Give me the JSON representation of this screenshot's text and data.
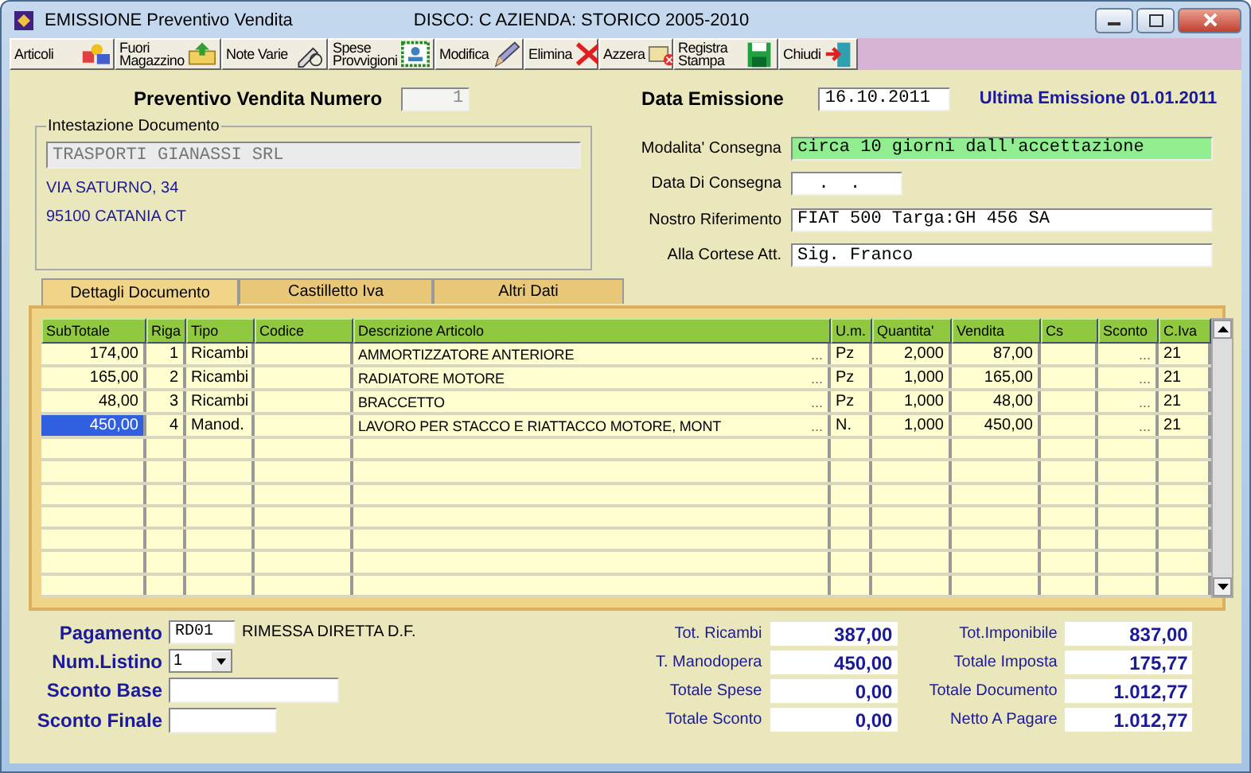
{
  "window": {
    "title": "EMISSIONE Preventivo Vendita",
    "subtitle": "DISCO: C   AZIENDA: STORICO 2005-2010"
  },
  "toolbar": [
    {
      "label": "Articoli"
    },
    {
      "label": "Fuori Magazzino"
    },
    {
      "label": "Note Varie"
    },
    {
      "label": "Spese Provvigioni"
    },
    {
      "label": "Modifica"
    },
    {
      "label": "Elimina"
    },
    {
      "label": "Azzera"
    },
    {
      "label": "Registra Stampa"
    },
    {
      "label": "Chiudi"
    }
  ],
  "header": {
    "number_label": "Preventivo Vendita Numero",
    "number": "1",
    "date_label": "Data Emissione",
    "date": "16.10.2011",
    "last_emission": "Ultima Emissione 01.01.2011"
  },
  "intestazione": {
    "legend": "Intestazione Documento",
    "name": "TRASPORTI GIANASSI SRL",
    "lines": [
      "VIA SATURNO, 34",
      "95100 CATANIA  CT"
    ]
  },
  "fields": [
    {
      "label": "Modalita' Consegna",
      "value": "circa 10 giorni dall'accettazione",
      "kind": "highlight"
    },
    {
      "label": "Data Di Consegna",
      "value": "  .  .",
      "kind": "short"
    },
    {
      "label": "Nostro Riferimento",
      "value": "FIAT 500 Targa:GH 456 SA",
      "kind": "normal"
    },
    {
      "label": "Alla Cortese Att.",
      "value": "Sig. Franco",
      "kind": "normal"
    }
  ],
  "tabs": [
    {
      "label": "Dettagli Documento",
      "selected": true
    },
    {
      "label": "Castilletto Iva",
      "selected": false
    },
    {
      "label": "Altri Dati",
      "selected": false
    }
  ],
  "table": {
    "columns": [
      "SubTotale",
      "Riga",
      "Tipo",
      "Codice",
      "Descrizione Articolo",
      "U.m.",
      "Quantita'",
      "Vendita",
      "Cs",
      "Sconto",
      "C.Iva"
    ],
    "rows": [
      {
        "subtotale": "174,00",
        "riga": "1",
        "tipo": "Ricambi",
        "descrizione": "AMMORTIZZATORE ANTERIORE",
        "more": "...",
        "um": "Pz",
        "quantita": "2,000",
        "vendita": "87,00",
        "sconto": "...",
        "iva": "21",
        "selected": false
      },
      {
        "subtotale": "165,00",
        "riga": "2",
        "tipo": "Ricambi",
        "descrizione": "RADIATORE MOTORE",
        "more": "...",
        "um": "Pz",
        "quantita": "1,000",
        "vendita": "165,00",
        "sconto": "...",
        "iva": "21",
        "selected": false
      },
      {
        "subtotale": "48,00",
        "riga": "3",
        "tipo": "Ricambi",
        "descrizione": "BRACCETTO",
        "more": "...",
        "um": "Pz",
        "quantita": "1,000",
        "vendita": "48,00",
        "sconto": "...",
        "iva": "21",
        "selected": false
      },
      {
        "subtotale": "450,00",
        "riga": "4",
        "tipo": "Manod.",
        "descrizione": "LAVORO PER STACCO E RIATTACCO MOTORE, MONT",
        "more": "...",
        "um": "N.",
        "quantita": "1,000",
        "vendita": "450,00",
        "sconto": "...",
        "iva": "21",
        "selected": true
      }
    ]
  },
  "payment": {
    "pagamento_label": "Pagamento",
    "pagamento_code": "RD01",
    "pagamento_desc": "RIMESSA DIRETTA D.F.",
    "listino_label": "Num.Listino",
    "listino": "1",
    "sconto_base_label": "Sconto Base",
    "sconto_finale_label": "Sconto Finale"
  },
  "totals_left": [
    {
      "label": "Tot. Ricambi",
      "value": "387,00"
    },
    {
      "label": "T. Manodopera",
      "value": "450,00"
    },
    {
      "label": "Totale Spese",
      "value": "0,00"
    },
    {
      "label": "Totale Sconto",
      "value": "0,00"
    }
  ],
  "totals_right": [
    {
      "label": "Tot.Imponibile",
      "value": "837,00"
    },
    {
      "label": "Totale Imposta",
      "value": "175,77"
    },
    {
      "label": "Totale Documento",
      "value": "1.012,77"
    },
    {
      "label": "Netto A Pagare",
      "value": "1.012,77"
    }
  ]
}
